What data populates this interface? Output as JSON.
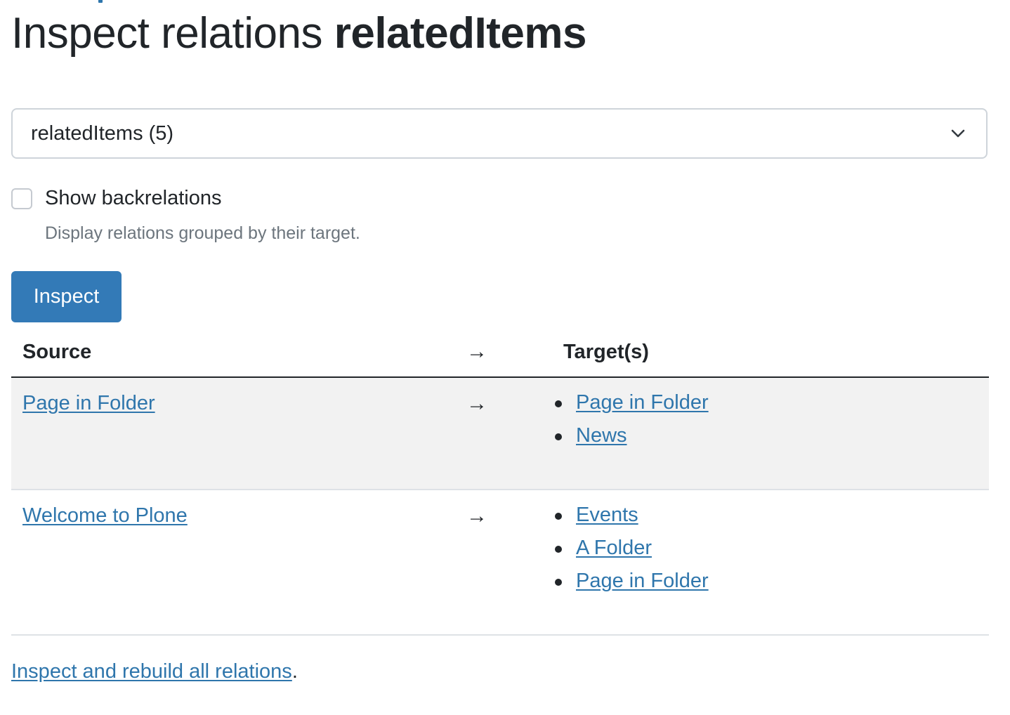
{
  "page": {
    "title_prefix": "Inspect relations",
    "title_name": "relatedItems"
  },
  "form": {
    "relation_select": {
      "selected": "relatedItems (5)"
    },
    "show_backrelations": {
      "label": "Show backrelations",
      "checked": false,
      "help": "Display relations grouped by their target."
    },
    "inspect_button": "Inspect"
  },
  "table": {
    "headers": {
      "source": "Source",
      "arrow": "→",
      "targets": "Target(s)"
    },
    "rows": [
      {
        "source": "Page in Folder",
        "arrow": "→",
        "targets": [
          "Page in Folder",
          "News"
        ]
      },
      {
        "source": "Welcome to Plone",
        "arrow": "→",
        "targets": [
          "Events",
          "A Folder",
          "Page in Folder"
        ]
      }
    ]
  },
  "footer": {
    "link": "Inspect and rebuild all relations",
    "suffix": "."
  },
  "colors": {
    "link": "#2f76ac",
    "button": "#337ab7",
    "row_stripe": "#f2f2f2"
  }
}
